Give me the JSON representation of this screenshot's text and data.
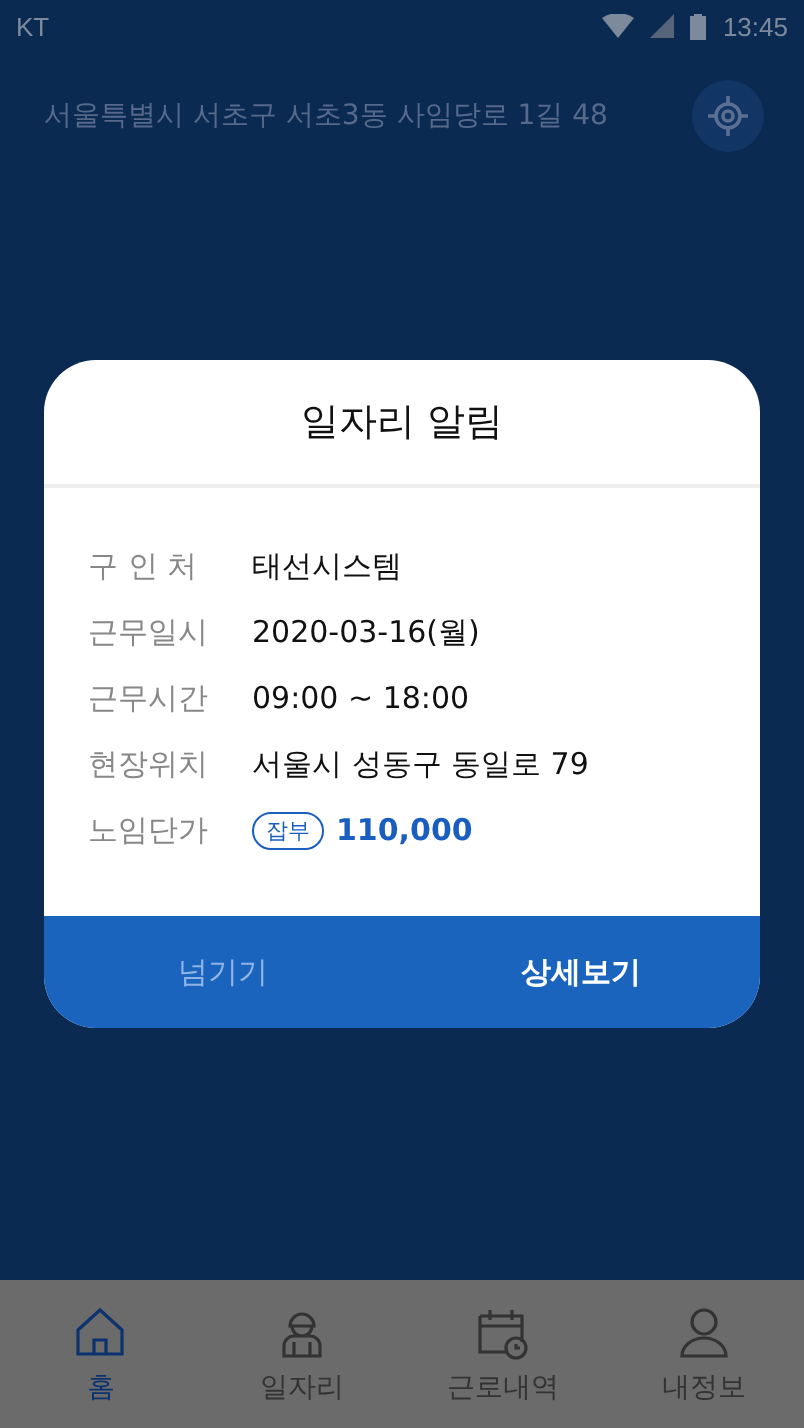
{
  "status_bar": {
    "carrier": "KT",
    "time": "13:45"
  },
  "address": "서울특별시 서초구 서초3동 사임당로 1길 48",
  "dialog": {
    "title": "일자리 알림",
    "rows": [
      {
        "kind": "text",
        "label": "구 인 처",
        "value": "태선시스템"
      },
      {
        "kind": "text",
        "label": "근무일시",
        "value": "2020-03-16(월)"
      },
      {
        "kind": "text",
        "label": "근무시간",
        "value": "09:00 ~ 18:00"
      },
      {
        "kind": "text",
        "label": "현장위치",
        "value": "서울시 성동구 동일로 79"
      },
      {
        "kind": "wage",
        "label": "노임단가",
        "badge": "잡부",
        "value": "110,000"
      }
    ],
    "buttons": [
      {
        "label": "넘기기",
        "primary": false
      },
      {
        "label": "상세보기",
        "primary": true
      }
    ]
  },
  "nav": [
    {
      "label": "홈",
      "selected": true
    },
    {
      "label": "일자리",
      "selected": false
    },
    {
      "label": "근로내역",
      "selected": false
    },
    {
      "label": "내정보",
      "selected": false
    }
  ]
}
